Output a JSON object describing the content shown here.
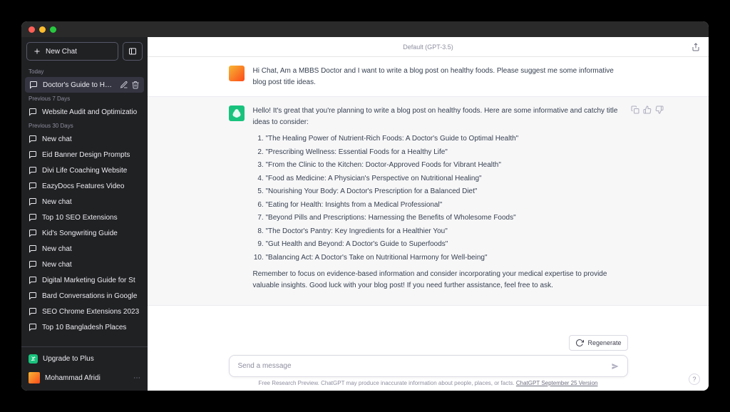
{
  "sidebar": {
    "new_chat_label": "New Chat",
    "sections": [
      {
        "label": "Today",
        "items": [
          {
            "label": "Doctor's Guide to Healt",
            "active": true
          }
        ]
      },
      {
        "label": "Previous 7 Days",
        "items": [
          {
            "label": "Website Audit and Optimizatio"
          }
        ]
      },
      {
        "label": "Previous 30 Days",
        "items": [
          {
            "label": "New chat"
          },
          {
            "label": "Eid Banner Design Prompts"
          },
          {
            "label": "Divi Life Coaching Website"
          },
          {
            "label": "EazyDocs Features Video"
          },
          {
            "label": "New chat"
          },
          {
            "label": "Top 10 SEO Extensions"
          },
          {
            "label": "Kid's Songwriting Guide"
          },
          {
            "label": "New chat"
          },
          {
            "label": "New chat"
          },
          {
            "label": "Digital Marketing Guide for St"
          },
          {
            "label": "Bard Conversations in Google"
          },
          {
            "label": "SEO Chrome Extensions 2023"
          },
          {
            "label": "Top 10 Bangladesh Places"
          }
        ]
      }
    ],
    "upgrade_label": "Upgrade to Plus",
    "user_name": "Mohammad Afridi"
  },
  "topbar": {
    "model_label": "Default (GPT-3.5)"
  },
  "messages": {
    "user_text": "Hi Chat, Am a MBBS Doctor and I want to write a blog post on healthy foods. Please suggest me some informative blog post title ideas.",
    "assistant_intro": "Hello! It's great that you're planning to write a blog post on healthy foods. Here are some informative and catchy title ideas to consider:",
    "assistant_list": [
      "\"The Healing Power of Nutrient-Rich Foods: A Doctor's Guide to Optimal Health\"",
      "\"Prescribing Wellness: Essential Foods for a Healthy Life\"",
      "\"From the Clinic to the Kitchen: Doctor-Approved Foods for Vibrant Health\"",
      "\"Food as Medicine: A Physician's Perspective on Nutritional Healing\"",
      "\"Nourishing Your Body: A Doctor's Prescription for a Balanced Diet\"",
      "\"Eating for Health: Insights from a Medical Professional\"",
      "\"Beyond Pills and Prescriptions: Harnessing the Benefits of Wholesome Foods\"",
      "\"The Doctor's Pantry: Key Ingredients for a Healthier You\"",
      "\"Gut Health and Beyond: A Doctor's Guide to Superfoods\"",
      "\"Balancing Act: A Doctor's Take on Nutritional Harmony for Well-being\""
    ],
    "assistant_outro": "Remember to focus on evidence-based information and consider incorporating your medical expertise to provide valuable insights. Good luck with your blog post! If you need further assistance, feel free to ask."
  },
  "bottom": {
    "regenerate_label": "Regenerate",
    "placeholder": "Send a message",
    "disclaimer_prefix": "Free Research Preview. ChatGPT may produce inaccurate information about people, places, or facts. ",
    "disclaimer_link": "ChatGPT September 25 Version"
  }
}
